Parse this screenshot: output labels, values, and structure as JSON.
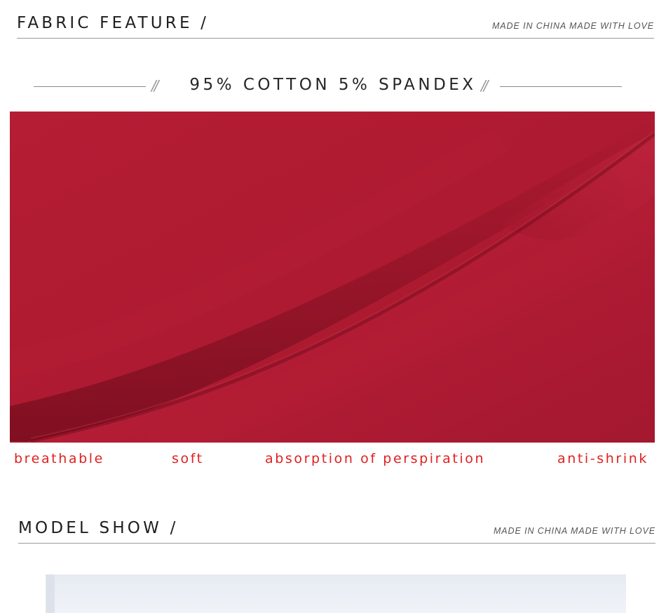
{
  "fabric_section": {
    "title": "FABRIC FEATURE /",
    "tagline": "MADE IN CHINA  MADE WITH LOVE"
  },
  "composition": {
    "text": "95% COTTON 5% SPANDEX",
    "divider_icon": "double-slash-icon"
  },
  "fabric_image": {
    "subject": "red knit fabric folds",
    "color": "#b01c33"
  },
  "features": [
    "breathable",
    "soft",
    "absorption of perspiration",
    "anti-shrink"
  ],
  "feature_color": "#e02020",
  "model_section": {
    "title": "MODEL SHOW /",
    "tagline": "MADE IN CHINA  MADE WITH LOVE"
  }
}
